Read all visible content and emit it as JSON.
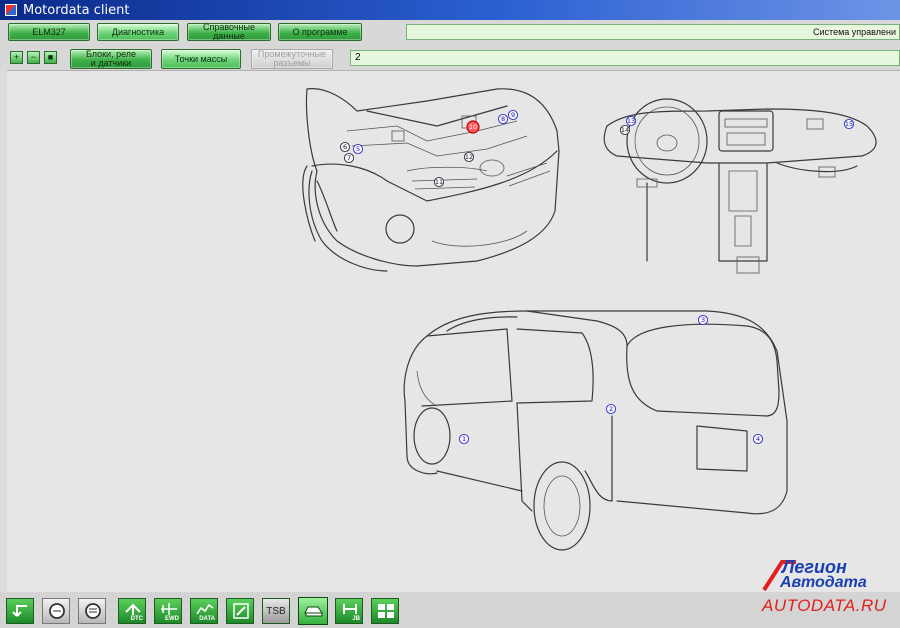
{
  "window": {
    "title": "Motordata client"
  },
  "menu": {
    "elm_label": "ELM327",
    "diagnostics_label": "Диагностика",
    "reference_label": "Справочные данные",
    "about_label": "О программе",
    "system_status": "Система управлени"
  },
  "subtabs": {
    "blocks_line1": "Блоки, реле",
    "blocks_line2": "и датчики",
    "ground_points": "Точки массы",
    "connectors_line1": "Промежуточные",
    "connectors_line2": "разъемы"
  },
  "zoom": {
    "zoom_in_glyph": "+",
    "zoom_out_glyph": "−",
    "fit_glyph": "■"
  },
  "breadcrumb": {
    "value": "2"
  },
  "markers": [
    {
      "id": "1",
      "label": "1"
    },
    {
      "id": "2",
      "label": "2"
    },
    {
      "id": "3",
      "label": "3"
    },
    {
      "id": "4",
      "label": "4"
    },
    {
      "id": "5",
      "label": "5"
    },
    {
      "id": "6",
      "label": "6"
    },
    {
      "id": "7",
      "label": "7"
    },
    {
      "id": "8",
      "label": "8"
    },
    {
      "id": "9",
      "label": "9"
    },
    {
      "id": "10",
      "label": "10",
      "selected": true
    },
    {
      "id": "11",
      "label": "11"
    },
    {
      "id": "12",
      "label": "12"
    },
    {
      "id": "13",
      "label": "13"
    },
    {
      "id": "14",
      "label": "14"
    },
    {
      "id": "15",
      "label": "15"
    }
  ],
  "toolbar": {
    "dtc_label": "DTC",
    "ewd_label": "EWD",
    "data_label": "DATA",
    "tsb_label": "TSB",
    "jb_label": "JB"
  },
  "logo": {
    "line1": "Легион",
    "line2": "Автодата",
    "url": "AUTODATA.RU"
  },
  "colors": {
    "accent_green": "#3fb24a",
    "title_blue": "#0a2a8a",
    "logo_blue": "#1a3fb0",
    "logo_red": "#e02020",
    "selected_marker": "#ff5a5a"
  }
}
